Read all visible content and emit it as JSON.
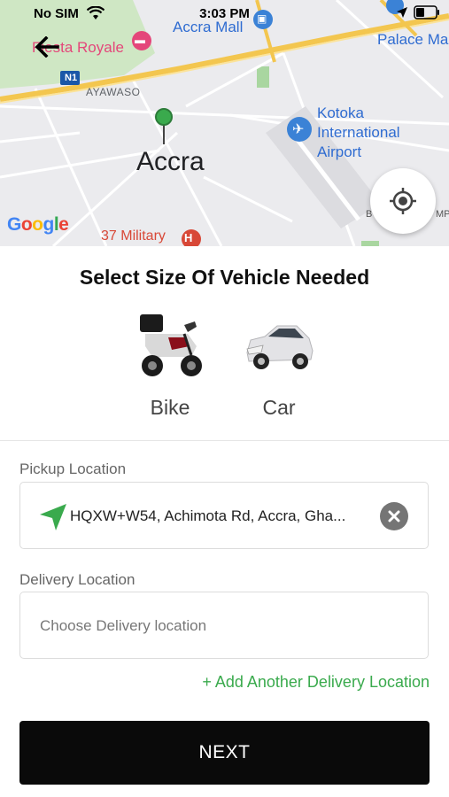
{
  "status": {
    "carrier": "No SIM",
    "time": "3:03 PM"
  },
  "map": {
    "city": "Accra",
    "district": "AYAWASO",
    "poi_hotel": "Fiesta Royale",
    "poi_mall": "Accra Mall",
    "poi_palace": "Palace Ma",
    "airport": [
      "Kotoka",
      "International",
      "Airport"
    ],
    "military": "37 Military",
    "road_badge": "N1",
    "edge_text": "B",
    "edge_text2": "MP",
    "attribution": "Google"
  },
  "sheet": {
    "title": "Select Size Of Vehicle Needed",
    "vehicles": [
      {
        "label": "Bike"
      },
      {
        "label": "Car"
      }
    ]
  },
  "pickup": {
    "label": "Pickup Location",
    "value": "HQXW+W54, Achimota Rd, Accra, Gha..."
  },
  "delivery": {
    "label": "Delivery Location",
    "placeholder": "Choose Delivery location"
  },
  "add_delivery": "+ Add Another Delivery Location",
  "next": "NEXT",
  "colors": {
    "accent_green": "#3aaa4d",
    "button_bg": "#0a0a0a",
    "pin_green": "#3aaa4d"
  }
}
